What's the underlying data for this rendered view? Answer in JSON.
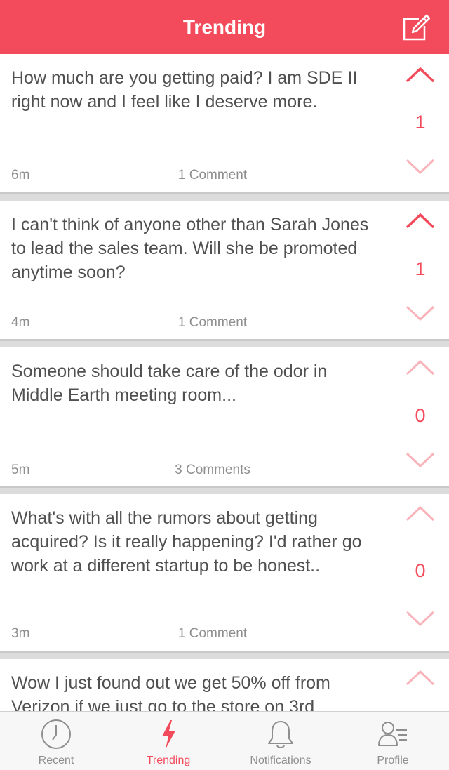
{
  "header": {
    "title": "Trending",
    "compose_icon": "compose-icon"
  },
  "accent_color": "#f34b5b",
  "posts": [
    {
      "text": "How much are you getting paid? I am SDE II right now and I feel like I deserve more.",
      "time": "6m",
      "comments": "1 Comment",
      "votes": "1",
      "upvoted": true
    },
    {
      "text": "I can't think of anyone other than Sarah Jones to lead the sales team. Will she be promoted anytime soon?",
      "time": "4m",
      "comments": "1 Comment",
      "votes": "1",
      "upvoted": true
    },
    {
      "text": "Someone should take care of the odor in Middle Earth meeting room...",
      "time": "5m",
      "comments": "3 Comments",
      "votes": "0",
      "upvoted": false
    },
    {
      "text": "What's with all the rumors about getting acquired? Is it really happening? I'd rather go work at a different startup to be honest..",
      "time": "3m",
      "comments": "1 Comment",
      "votes": "0",
      "upvoted": false
    },
    {
      "text": "Wow I just found out we get 50% off from Verizon if we just go to the store on 3rd",
      "upvoted": false
    }
  ],
  "tabs": [
    {
      "label": "Recent",
      "icon": "clock-icon",
      "active": false
    },
    {
      "label": "Trending",
      "icon": "lightning-icon",
      "active": true
    },
    {
      "label": "Notifications",
      "icon": "bell-icon",
      "active": false
    },
    {
      "label": "Profile",
      "icon": "profile-icon",
      "active": false
    }
  ]
}
